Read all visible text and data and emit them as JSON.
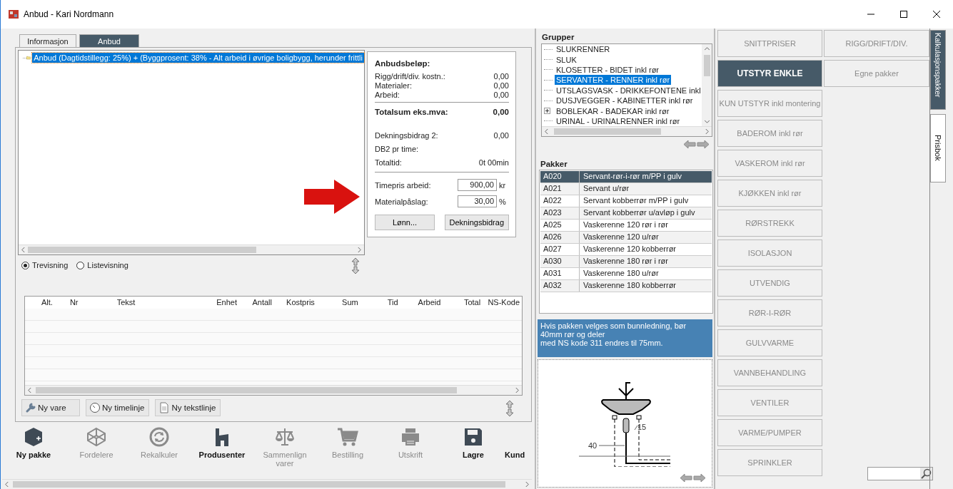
{
  "window": {
    "title": "Anbud - Kari Nordmann"
  },
  "tabs": [
    {
      "label": "Informasjon",
      "selected": false
    },
    {
      "label": "Anbud",
      "selected": true
    }
  ],
  "tree": {
    "items": [
      {
        "label": "Anbud (Dagtidstillegg: 25%) + (Byggprosent: 38% - Alt arbeid i øvrige boligbygg, herunder frittli",
        "selected": true
      }
    ]
  },
  "summary": {
    "title": "Anbudsbeløp:",
    "cost_rows": [
      {
        "label": "Rigg/drift/div. kostn.:",
        "value": "0,00"
      },
      {
        "label": "Materialer:",
        "value": "0,00"
      },
      {
        "label": "Arbeid:",
        "value": "0,00"
      }
    ],
    "total": {
      "label": "Totalsum eks.mva:",
      "value": "0,00"
    },
    "margin_rows": [
      {
        "label": "Dekningsbidrag 2:",
        "value": "0,00"
      },
      {
        "label": "DB2 pr time:"
      },
      {
        "label": "Totaltid:",
        "value": "0t 00min"
      }
    ],
    "inputs": [
      {
        "label": "Timepris arbeid:",
        "value": "900,00",
        "unit": "kr"
      },
      {
        "label": "Materialpåslag:",
        "value": "30,00",
        "unit": "%"
      }
    ],
    "buttons": [
      "Lønn...",
      "Dekningsbidrag"
    ]
  },
  "view_options": [
    {
      "label": "Trevisning",
      "selected": true
    },
    {
      "label": "Listevisning",
      "selected": false
    }
  ],
  "table": {
    "columns": [
      "Alt.",
      "Nr",
      "Tekst",
      "Enhet",
      "Antall",
      "Kostpris",
      "Sum",
      "Tid",
      "Arbeid",
      "Total",
      "NS-Kode"
    ]
  },
  "line_buttons": [
    {
      "label": "Ny vare",
      "kind": "tool"
    },
    {
      "label": "Ny timelinje",
      "kind": "clock"
    },
    {
      "label": "Ny tekstlinje",
      "kind": "document"
    }
  ],
  "toolbar": [
    {
      "label": "Ny pakke",
      "kind": "package",
      "disabled": false
    },
    {
      "label": "Fordelere",
      "kind": "network",
      "disabled": true
    },
    {
      "label": "Rekalkuler",
      "kind": "refresh",
      "disabled": true
    },
    {
      "label": "Produsenter",
      "kind": "factory",
      "disabled": false
    },
    {
      "label": "Sammenlign varer",
      "kind": "scales",
      "disabled": true
    },
    {
      "label": "Bestilling",
      "kind": "cart",
      "disabled": true
    },
    {
      "label": "Utskrift",
      "kind": "printer",
      "disabled": true
    },
    {
      "label": "Lagre",
      "kind": "save",
      "disabled": false
    },
    {
      "label": "Kund",
      "kind": "other",
      "disabled": false
    }
  ],
  "groups": {
    "title": "Grupper",
    "items": [
      {
        "label": "SLUKRENNER",
        "selected": false,
        "expandable": false
      },
      {
        "label": "SLUK",
        "selected": false,
        "expandable": false
      },
      {
        "label": "KLOSETTER  -  BIDET inkl rør",
        "selected": false,
        "expandable": false
      },
      {
        "label": "SERVANTER - RENNER inkl rør",
        "selected": true,
        "expandable": false
      },
      {
        "label": "UTSLAGSVASK - DRIKKEFONTENE inkl",
        "selected": false,
        "expandable": false
      },
      {
        "label": "DUSJVEGGER - KABINETTER inkl rør",
        "selected": false,
        "expandable": false
      },
      {
        "label": "BOBLEKAR  -  BADEKAR inkl rør",
        "selected": false,
        "expandable": true
      },
      {
        "label": "URINAL  - URINALRENNER inkl rør",
        "selected": false,
        "expandable": false
      }
    ]
  },
  "packages": {
    "title": "Pakker",
    "rows": [
      {
        "code": "A020",
        "description": "Servant-rør-i-rør m/PP i gulv",
        "selected": true
      },
      {
        "code": "A021",
        "description": "Servant u/rør",
        "selected": false
      },
      {
        "code": "A022",
        "description": "Servant kobberrør m/PP i gulv",
        "selected": false
      },
      {
        "code": "A023",
        "description": "Servant kobberrør u/avløp i gulv",
        "selected": false
      },
      {
        "code": "A025",
        "description": "Vaskerenne 120  rør i rør",
        "selected": false
      },
      {
        "code": "A026",
        "description": "Vaskerenne 120 u/rør",
        "selected": false
      },
      {
        "code": "A027",
        "description": "Vaskerenne 120 kobberrør",
        "selected": false
      },
      {
        "code": "A030",
        "description": "Vaskerenne 180  rør i rør",
        "selected": false
      },
      {
        "code": "A031",
        "description": "Vaskerenne 180 u/rør",
        "selected": false
      },
      {
        "code": "A032",
        "description": "Vaskerenne 180  kobberrør",
        "selected": false
      }
    ]
  },
  "note": "Hvis pakken velges som bunnledning, bør 40mm rør og deler\nmed NS kode 311 endres til 75mm.",
  "drawing": {
    "labels": [
      "40",
      "15"
    ]
  },
  "categories": [
    {
      "label": "SNITTPRISER",
      "selected": false
    },
    {
      "label": "RIGG/DRIFT/DIV.",
      "selected": false
    },
    {
      "label": "UTSTYR ENKLE",
      "selected": true
    },
    {
      "label": "Egne pakker",
      "selected": false
    },
    {
      "label": "KUN UTSTYR inkl montering",
      "selected": false
    },
    {
      "label": "BADEROM inkl rør",
      "selected": false
    },
    {
      "label": "VASKEROM inkl rør",
      "selected": false
    },
    {
      "label": "KJØKKEN inkl rør",
      "selected": false
    },
    {
      "label": "RØRSTREKK",
      "selected": false
    },
    {
      "label": "ISOLASJON",
      "selected": false
    },
    {
      "label": "UTVENDIG",
      "selected": false
    },
    {
      "label": "RØR-I-RØR",
      "selected": false
    },
    {
      "label": "GULVVARME",
      "selected": false
    },
    {
      "label": "VANNBEHANDLING",
      "selected": false
    },
    {
      "label": "VENTILER",
      "selected": false
    },
    {
      "label": "VARME/PUMPER",
      "selected": false
    },
    {
      "label": "SPRINKLER",
      "selected": false
    }
  ],
  "side_tabs": [
    {
      "label": "Kalkulasjonspakker",
      "selected": true
    },
    {
      "label": "Prisbok",
      "selected": false
    }
  ]
}
